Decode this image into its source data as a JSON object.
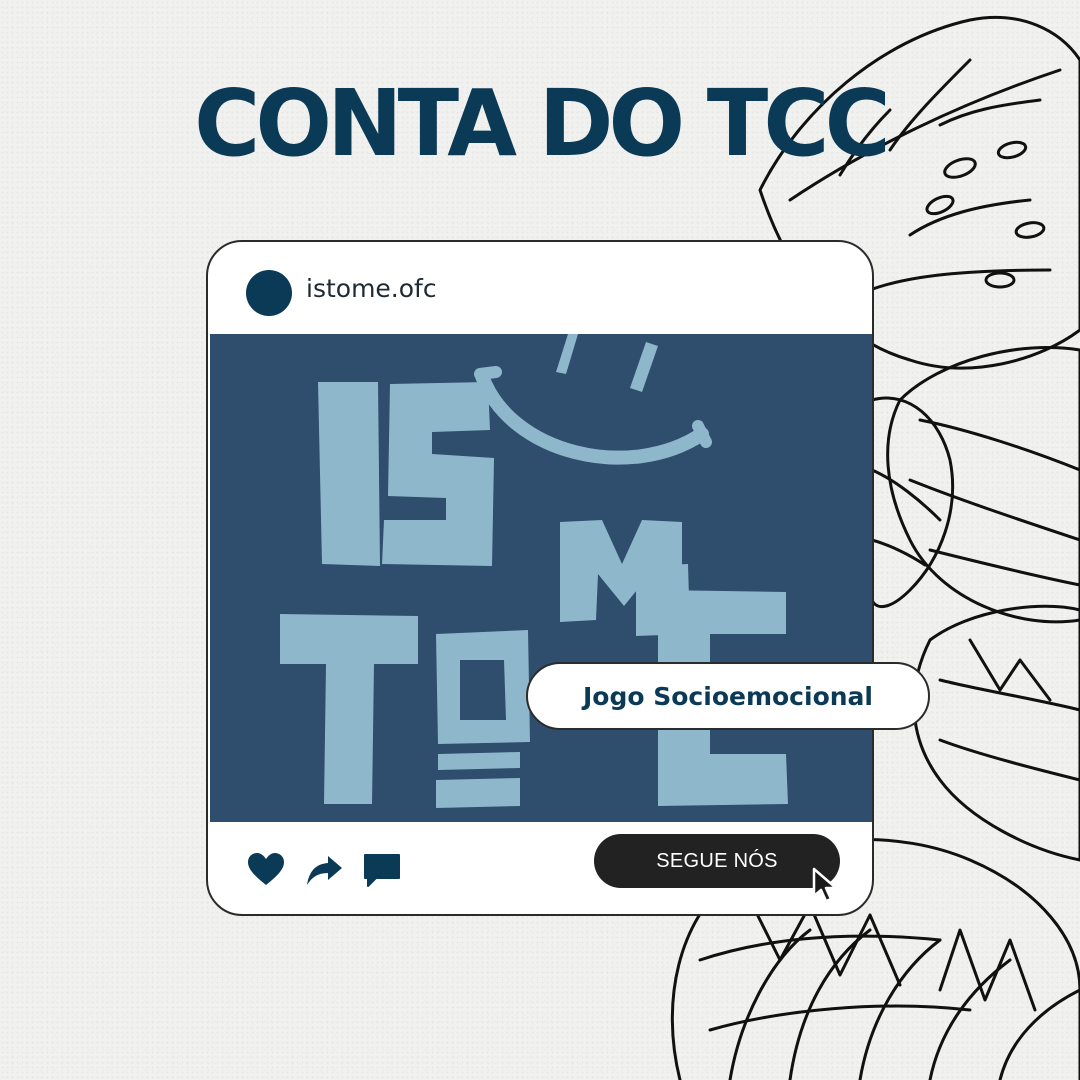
{
  "headline": "CONTA DO TCC",
  "post": {
    "username": "istome.ofc",
    "tag_label": "Jogo Socioemocional",
    "follow_button_label": "SEGUE NÓS",
    "image": {
      "logo_letters": [
        "IS",
        "TO",
        "M",
        "E"
      ],
      "background_color": "#2f4d6d",
      "logo_color": "#8fb7cc"
    },
    "actions": [
      "heart-icon",
      "share-icon",
      "comment-icon"
    ]
  },
  "colors": {
    "brand_navy": "#0b3a57",
    "button_dark": "#222222",
    "page_background": "#f1f1ef"
  }
}
